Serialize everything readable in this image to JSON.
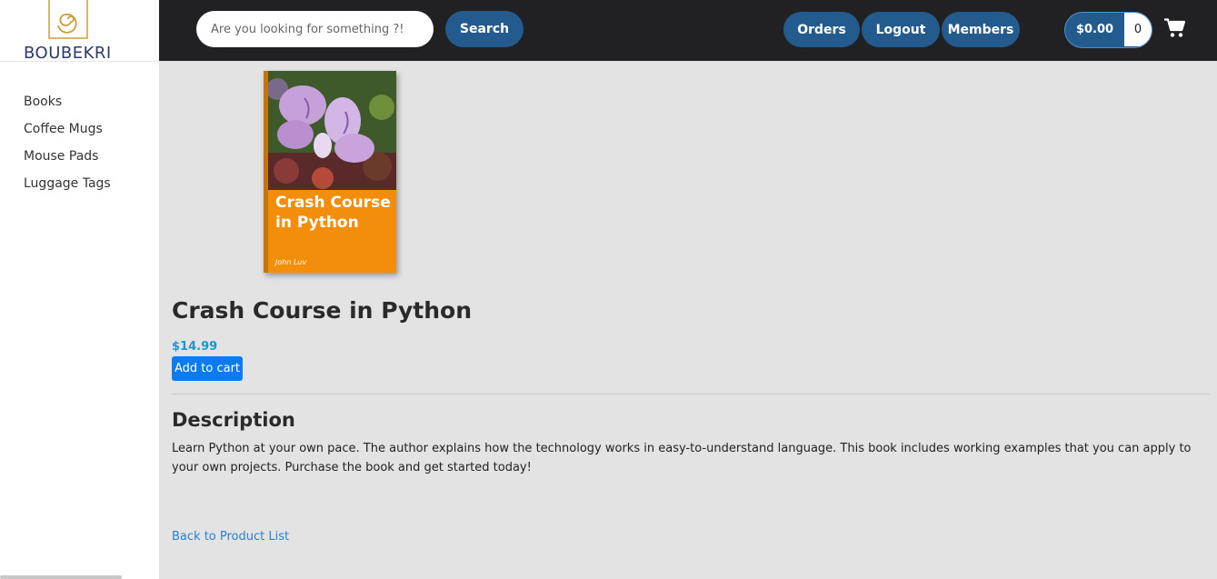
{
  "brand": {
    "name": "BOUBEKRI",
    "logo_icon": "spiral-icon",
    "accent": "#c9a03a"
  },
  "sidebar": {
    "items": [
      {
        "label": "Books"
      },
      {
        "label": "Coffee Mugs"
      },
      {
        "label": "Mouse Pads"
      },
      {
        "label": "Luggage Tags"
      }
    ]
  },
  "header": {
    "search_placeholder": "Are you looking for something ?!",
    "search_label": "Search",
    "orders_label": "Orders",
    "logout_label": "Logout",
    "members_label": "Members",
    "cart_total": "$0.00",
    "cart_count": "0",
    "cart_icon": "shopping-cart-icon",
    "bar_color": "#212123",
    "button_color": "#245b8e"
  },
  "product": {
    "cover_title": "Crash Course in Python",
    "cover_author": "John Luv",
    "title": "Crash Course in Python",
    "price": "$14.99",
    "add_to_cart_label": "Add to cart",
    "description_heading": "Description",
    "description": "Learn Python at your own pace. The author explains how the technology works in easy-to-understand language. This book includes working examples that you can apply to your own projects. Purchase the book and get started today!",
    "back_link": "Back to Product List",
    "price_color": "#1a98d6",
    "cover_color": "#f28e0c"
  }
}
